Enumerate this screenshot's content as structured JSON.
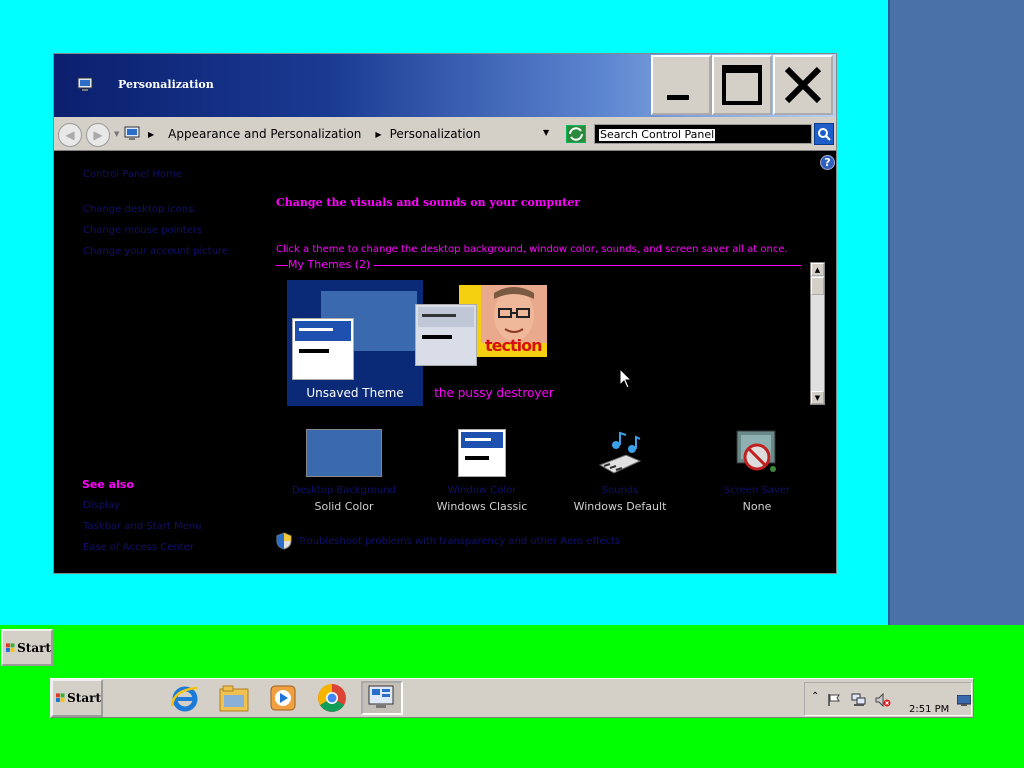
{
  "colors": {
    "desktop_cyan": "#00ffff",
    "taskbar_green": "#00ff00",
    "accent_magenta": "#ff00ff",
    "title_gradient_start": "#0b1f6e"
  },
  "outer_taskbar": {
    "start_label": "Start"
  },
  "window": {
    "title": "Personalization",
    "minimize_icon": "minimize-icon",
    "maximize_icon": "maximize-icon",
    "close_icon": "close-icon"
  },
  "address": {
    "breadcrumbs": [
      "Appearance and Personalization",
      "Personalization"
    ],
    "search_value": "Search Control Panel"
  },
  "sidebar": {
    "links": [
      "Control Panel Home",
      "Change desktop icons",
      "Change mouse pointers",
      "Change your account picture"
    ],
    "see_also_title": "See also",
    "see_also_links": [
      "Display",
      "Taskbar and Start Menu",
      "Ease of Access Center"
    ]
  },
  "main": {
    "heading": "Change the visuals and sounds on your computer",
    "subtext": "Click a theme to change the desktop background, window color, sounds, and screen saver all at once.",
    "my_themes_label": "My Themes (2)",
    "themes": [
      {
        "name": "Unsaved Theme",
        "selected": true
      },
      {
        "name": "the pussy destroyer",
        "selected": false
      }
    ],
    "photo_text": "tection",
    "bottom_items": [
      {
        "link": "Desktop Background",
        "name": "Solid Color"
      },
      {
        "link": "Window Color",
        "name": "Windows Classic"
      },
      {
        "link": "Sounds",
        "name": "Windows Default"
      },
      {
        "link": "Screen Saver",
        "name": "None"
      }
    ],
    "shield_text": "Troubleshoot problems with transparency and other Aero effects"
  },
  "taskbar": {
    "start_label": "Start",
    "clock": "2:51 PM"
  }
}
